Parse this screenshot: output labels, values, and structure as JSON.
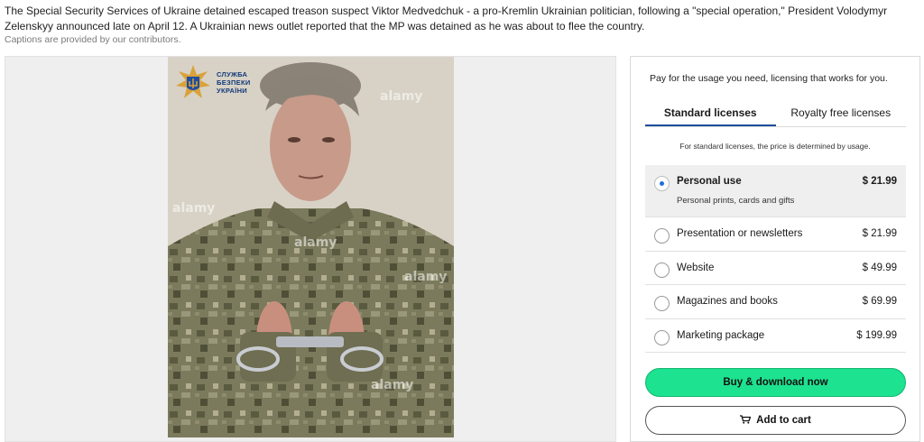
{
  "caption": {
    "text": "The Special Security Services of Ukraine detained escaped treason suspect Viktor Medvedchuk - a pro-Kremlin Ukrainian politician, following a \"special operation,\" President Volodymyr Zelenskyy announced late on April 12. A Ukrainian news outlet reported that the MP was detained as he was about to flee the country.",
    "note": "Captions are provided by our contributors."
  },
  "image": {
    "logo_text": [
      "СЛУЖБА",
      "БЕЗПЕКИ",
      "УКРАЇНИ"
    ],
    "watermark": "alamy",
    "watermark_icon": "alamy-watermark"
  },
  "license": {
    "intro": "Pay for the usage you need, licensing that works for you.",
    "tabs": [
      {
        "label": "Standard licenses",
        "active": true
      },
      {
        "label": "Royalty free licenses",
        "active": false
      }
    ],
    "usage_note": "For standard licenses, the price is determined by usage.",
    "options": [
      {
        "label": "Personal use",
        "sub": "Personal prints, cards and gifts",
        "price": "$ 21.99",
        "selected": true
      },
      {
        "label": "Presentation or newsletters",
        "price": "$ 21.99",
        "selected": false
      },
      {
        "label": "Website",
        "price": "$ 49.99",
        "selected": false
      },
      {
        "label": "Magazines and books",
        "price": "$ 69.99",
        "selected": false
      },
      {
        "label": "Marketing package",
        "price": "$ 199.99",
        "selected": false
      }
    ],
    "buy_label": "Buy & download now",
    "cart_label": "Add to cart",
    "colors": {
      "accent": "#1de28f",
      "tab_underline": "#1f4e9e",
      "radio_dot": "#1f6fe0"
    }
  }
}
